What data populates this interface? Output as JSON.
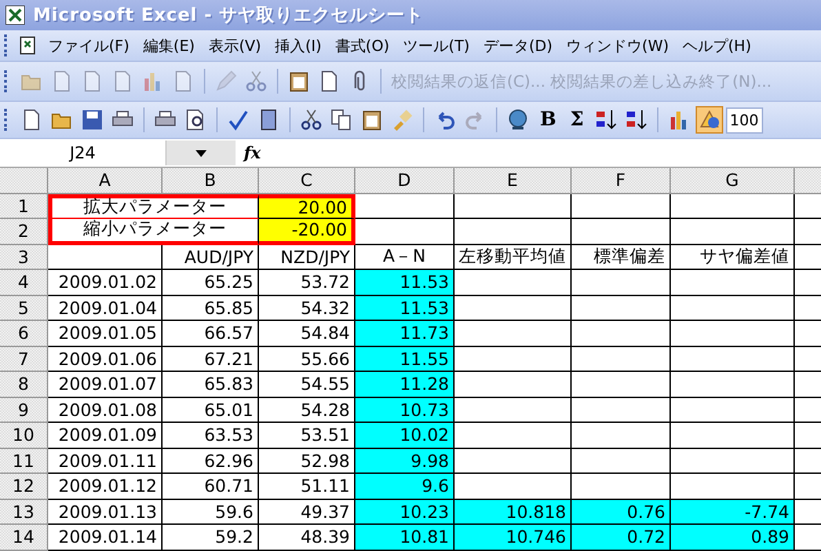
{
  "window": {
    "title": "Microsoft Excel - サヤ取りエクセルシート"
  },
  "menu": [
    "ファイル(F)",
    "編集(E)",
    "表示(V)",
    "挿入(I)",
    "書式(O)",
    "ツール(T)",
    "データ(D)",
    "ウィンドウ(W)",
    "ヘルプ(H)"
  ],
  "review_toolbar": {
    "text": "校閲結果の返信(C)... 校閲結果の差し込み終了(N)..."
  },
  "standard_toolbar": {
    "bold": "B",
    "autosum": "Σ",
    "drawing_button": {
      "selected": true
    },
    "zoom": "100"
  },
  "formula_bar": {
    "name_box": "J24",
    "fx": "fx"
  },
  "columns": [
    "A",
    "B",
    "C",
    "D",
    "E",
    "F",
    "G"
  ],
  "parameters": [
    {
      "row": "1",
      "label": "拡大パラメーター",
      "value": "20.00"
    },
    {
      "row": "2",
      "label": "縮小パラメーター",
      "value": "-20.00"
    }
  ],
  "header_row": {
    "row": "3",
    "labels": [
      "AUD/JPY",
      "NZD/JPY",
      "A－N",
      "左移動平均値",
      "標準偏差",
      "サヤ偏差値"
    ]
  },
  "rows": [
    {
      "row": "4",
      "date": "2009.01.02",
      "aud": "65.25",
      "nzd": "53.72",
      "spread": "11.53"
    },
    {
      "row": "5",
      "date": "2009.01.04",
      "aud": "65.85",
      "nzd": "54.32",
      "spread": "11.53"
    },
    {
      "row": "6",
      "date": "2009.01.05",
      "aud": "66.57",
      "nzd": "54.84",
      "spread": "11.73"
    },
    {
      "row": "7",
      "date": "2009.01.06",
      "aud": "67.21",
      "nzd": "55.66",
      "spread": "11.55"
    },
    {
      "row": "8",
      "date": "2009.01.07",
      "aud": "65.83",
      "nzd": "54.55",
      "spread": "11.28"
    },
    {
      "row": "9",
      "date": "2009.01.08",
      "aud": "65.01",
      "nzd": "54.28",
      "spread": "10.73"
    },
    {
      "row": "10",
      "date": "2009.01.09",
      "aud": "63.53",
      "nzd": "53.51",
      "spread": "10.02"
    },
    {
      "row": "11",
      "date": "2009.01.11",
      "aud": "62.96",
      "nzd": "52.98",
      "spread": "9.98"
    },
    {
      "row": "12",
      "date": "2009.01.12",
      "aud": "60.71",
      "nzd": "51.11",
      "spread": "9.6"
    },
    {
      "row": "13",
      "date": "2009.01.13",
      "aud": "59.6",
      "nzd": "49.37",
      "spread": "10.23",
      "average": "10.818",
      "stdev": "0.76",
      "deviation": "-7.74"
    },
    {
      "row": "14",
      "date": "2009.01.14",
      "aud": "59.2",
      "nzd": "48.39",
      "spread": "10.81",
      "average": "10.746",
      "stdev": "0.72",
      "deviation": "0.89"
    }
  ]
}
